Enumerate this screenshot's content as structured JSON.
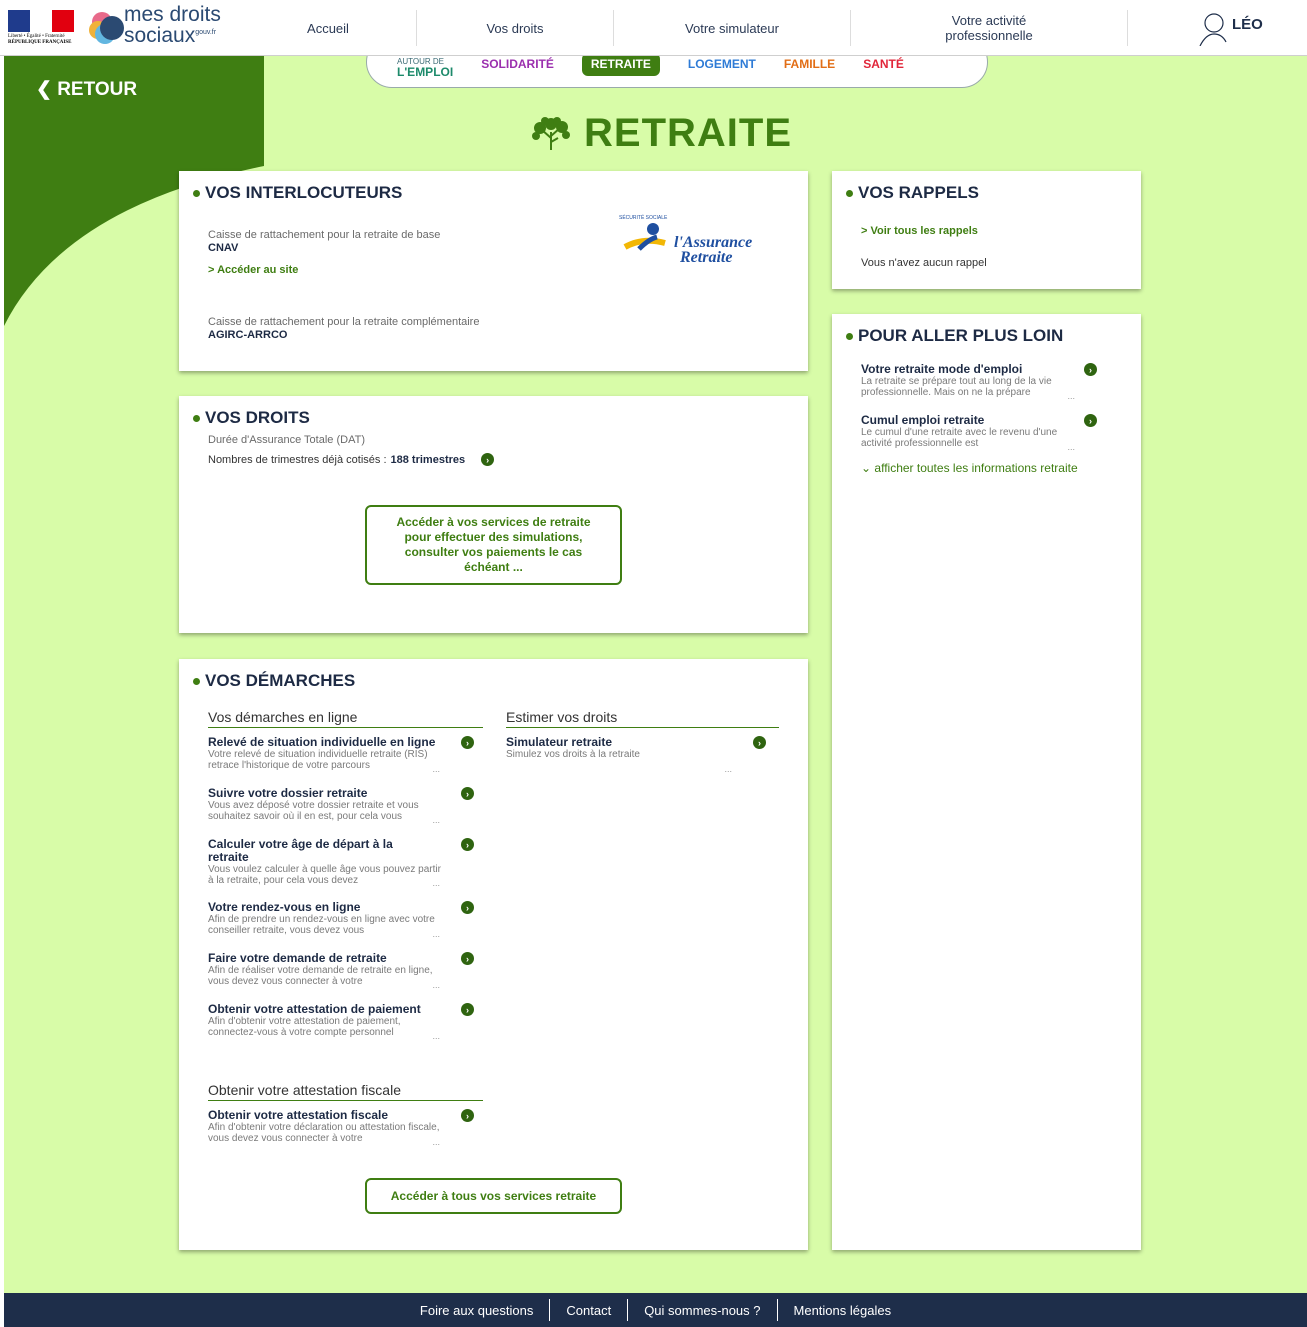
{
  "header": {
    "marianne_motto": "Liberté • Égalité • Fraternité",
    "marianne_republic": "RÉPUBLIQUE FRANÇAISE",
    "logo_line1": "mes droits",
    "logo_line2": "sociaux",
    "logo_gouv": "gouv.fr",
    "nav": [
      "Accueil",
      "Vos droits",
      "Votre simulateur",
      "Votre activité professionnelle"
    ],
    "user_name": "LÉO"
  },
  "back_label": "RETOUR",
  "subnav": {
    "items": [
      {
        "small": "AUTOUR DE",
        "label": "L'EMPLOI",
        "color": "#1d8a6b"
      },
      {
        "small": "",
        "label": "SOLIDARITÉ",
        "color": "#9b2fae"
      },
      {
        "small": "",
        "label": "RETRAITE",
        "color": "#ffffff"
      },
      {
        "small": "",
        "label": "LOGEMENT",
        "color": "#2e7bd6"
      },
      {
        "small": "",
        "label": "FAMILLE",
        "color": "#e26e16"
      },
      {
        "small": "",
        "label": "SANTÉ",
        "color": "#e1263a"
      }
    ]
  },
  "page_title": "RETRAITE",
  "interlocuteurs": {
    "title": "VOS INTERLOCUTEURS",
    "base_label": "Caisse de rattachement pour la retraite de base",
    "base_value": "CNAV",
    "access_link": "> Accéder au site",
    "comp_label": "Caisse de rattachement pour la retraite complémentaire",
    "comp_value": "AGIRC-ARRCO",
    "logo_small": "SÉCURITÉ SOCIALE",
    "logo_line1": "l'Assurance",
    "logo_line2": "Retraite"
  },
  "droits": {
    "title": "VOS DROITS",
    "dat_label": "Durée d'Assurance Totale (DAT)",
    "trimestres_label": "Nombres de trimestres déjà cotisés :",
    "trimestres_value": "188 trimestres",
    "button": "Accéder à vos services de retraite pour effectuer des simulations, consulter vos paiements le cas échéant ..."
  },
  "demarches": {
    "title": "VOS DÉMARCHES",
    "col1_head": "Vos démarches en ligne",
    "col2_head": "Estimer vos droits",
    "col3_head": "Obtenir votre attestation fiscale",
    "online": [
      {
        "title": "Relevé de situation individuelle en ligne",
        "desc": "Votre relevé de situation individuelle retraite (RIS) retrace l'historique de votre parcours"
      },
      {
        "title": "Suivre votre dossier retraite",
        "desc": "Vous avez déposé votre dossier retraite et vous souhaitez savoir où il en est, pour cela vous"
      },
      {
        "title": "Calculer votre âge de départ à la retraite",
        "desc": "Vous voulez calculer à quelle âge vous pouvez partir à la retraite,  pour cela vous devez"
      },
      {
        "title": "Votre rendez-vous en ligne",
        "desc": "Afin de prendre un rendez-vous en ligne avec votre conseiller retraite, vous devez vous"
      },
      {
        "title": "Faire votre demande de retraite",
        "desc": "Afin de réaliser votre demande de retraite en ligne, vous devez vous connecter à votre"
      },
      {
        "title": "Obtenir votre attestation de paiement",
        "desc": "Afin d'obtenir votre attestation de paiement, connectez-vous à votre compte personnel"
      }
    ],
    "estimate": {
      "title": "Simulateur retraite",
      "desc": "Simulez vos droits à la retraite"
    },
    "fiscal": {
      "title": "Obtenir votre attestation fiscale",
      "desc": "Afin d'obtenir votre déclaration ou attestation fiscale, vous devez vous connecter à votre"
    },
    "button": "Accéder à tous vos services retraite",
    "ellipsis": "..."
  },
  "rappels": {
    "title": "VOS RAPPELS",
    "link": "> Voir tous les rappels",
    "empty": "Vous n'avez aucun rappel"
  },
  "plus_loin": {
    "title": "POUR ALLER PLUS LOIN",
    "items": [
      {
        "title": "Votre retraite mode d'emploi",
        "desc": "La retraite se prépare tout au long de la vie professionnelle. Mais on ne la prépare"
      },
      {
        "title": "Cumul emploi retraite",
        "desc": "Le cumul d'une retraite avec le revenu d'une activité professionnelle est"
      }
    ],
    "show_all": "afficher toutes les informations retraite"
  },
  "footer": [
    "Foire aux questions",
    "Contact",
    "Qui sommes-nous ?",
    "Mentions légales"
  ],
  "colors": {
    "accent": "#3f7e12",
    "background": "#d8fca8",
    "navy": "#1e2e4a"
  },
  "icons": [
    "user-icon",
    "tree-icon",
    "chevron-left-icon",
    "arrow-right-circle-icon",
    "chevron-down-icon"
  ]
}
